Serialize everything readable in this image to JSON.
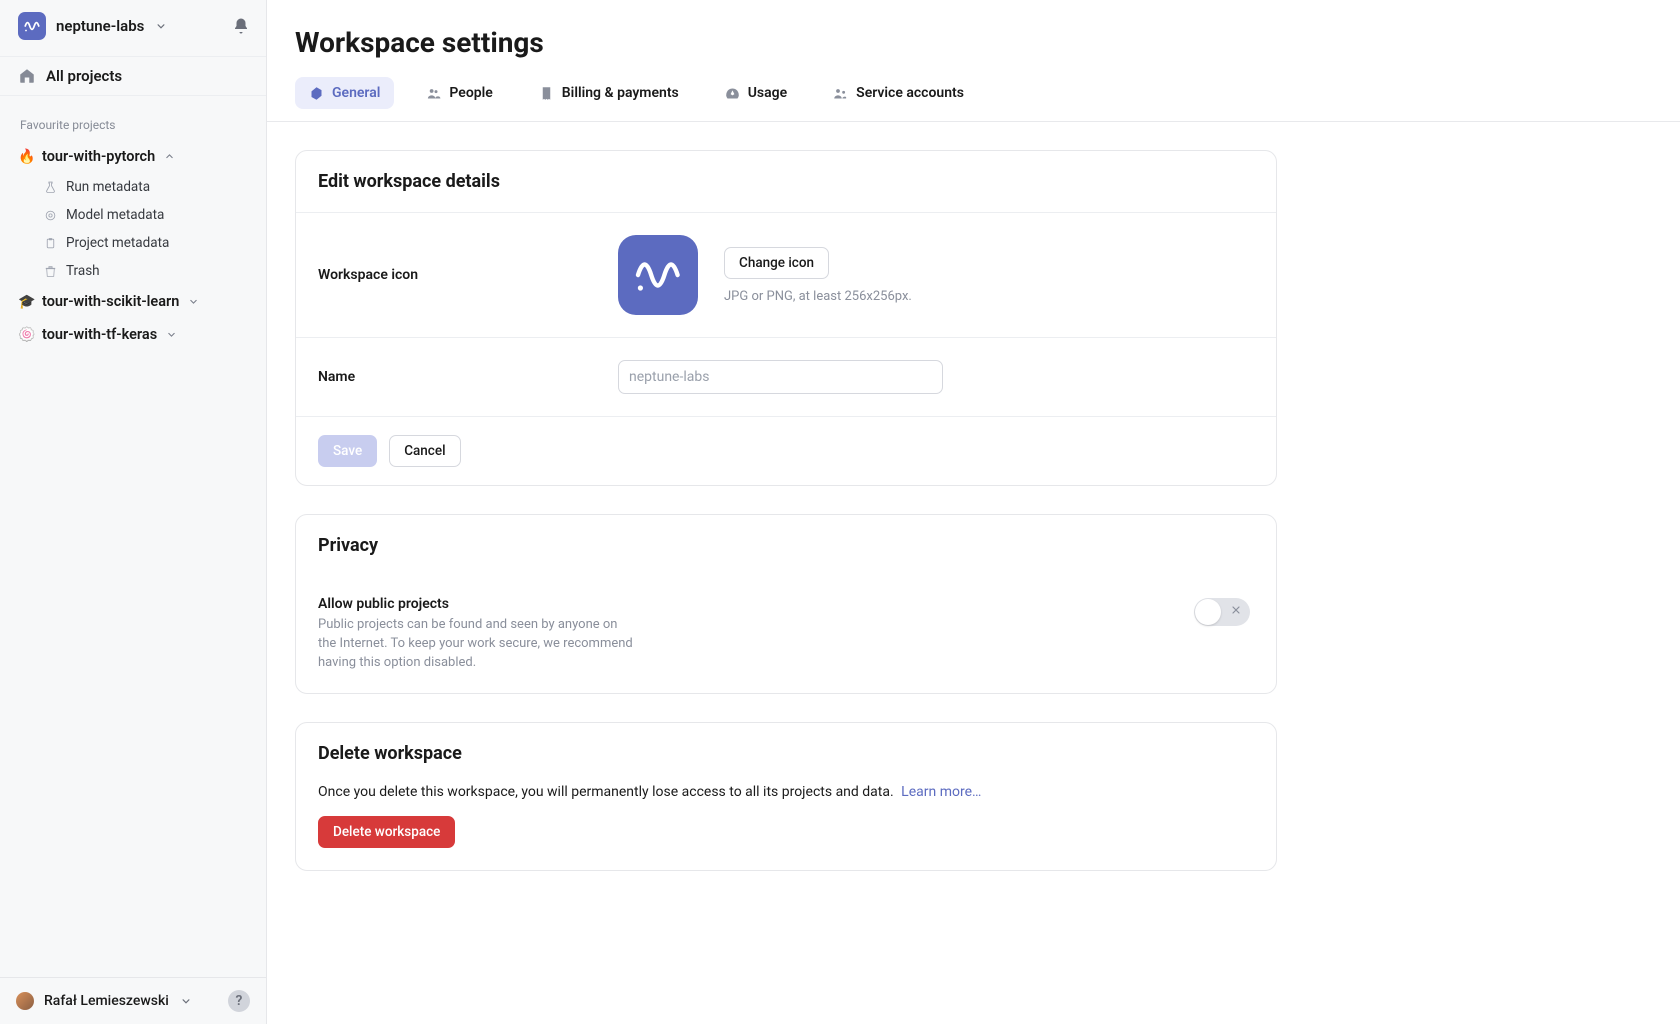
{
  "colors": {
    "accent": "#5c6bc0",
    "danger": "#d73a3a"
  },
  "workspace": {
    "name": "neptune-labs"
  },
  "sidebar": {
    "all_projects": "All projects",
    "fav_section": "Favourite projects",
    "projects": [
      {
        "name": "tour-with-pytorch",
        "emoji": "🔥",
        "expanded": true,
        "children": [
          {
            "icon": "flask",
            "label": "Run metadata"
          },
          {
            "icon": "target",
            "label": "Model metadata"
          },
          {
            "icon": "clipboard",
            "label": "Project metadata"
          },
          {
            "icon": "trash",
            "label": "Trash"
          }
        ]
      },
      {
        "name": "tour-with-scikit-learn",
        "emoji": "🎓",
        "expanded": false
      },
      {
        "name": "tour-with-tf-keras",
        "emoji": "🍥",
        "expanded": false
      }
    ]
  },
  "user": {
    "name": "Rafał Lemieszewski"
  },
  "page": {
    "title": "Workspace settings"
  },
  "tabs": [
    {
      "id": "general",
      "label": "General",
      "icon": "hex",
      "active": true
    },
    {
      "id": "people",
      "label": "People",
      "icon": "people",
      "active": false
    },
    {
      "id": "billing",
      "label": "Billing & payments",
      "icon": "receipt",
      "active": false
    },
    {
      "id": "usage",
      "label": "Usage",
      "icon": "gauge",
      "active": false
    },
    {
      "id": "service",
      "label": "Service accounts",
      "icon": "service",
      "active": false
    }
  ],
  "details": {
    "header": "Edit workspace details",
    "icon_label": "Workspace icon",
    "change_icon": "Change icon",
    "icon_hint": "JPG or PNG, at least 256x256px.",
    "name_label": "Name",
    "name_placeholder": "neptune-labs",
    "name_value": "",
    "save": "Save",
    "cancel": "Cancel"
  },
  "privacy": {
    "header": "Privacy",
    "toggle_label": "Allow public projects",
    "toggle_desc": "Public projects can be found and seen by anyone on the Internet. To keep your work secure, we recommend having this option disabled.",
    "toggle_state": false
  },
  "delete": {
    "header": "Delete workspace",
    "text": "Once you delete this workspace, you will permanently lose access to all its projects and data.",
    "learn_more": "Learn more…",
    "button": "Delete workspace"
  }
}
